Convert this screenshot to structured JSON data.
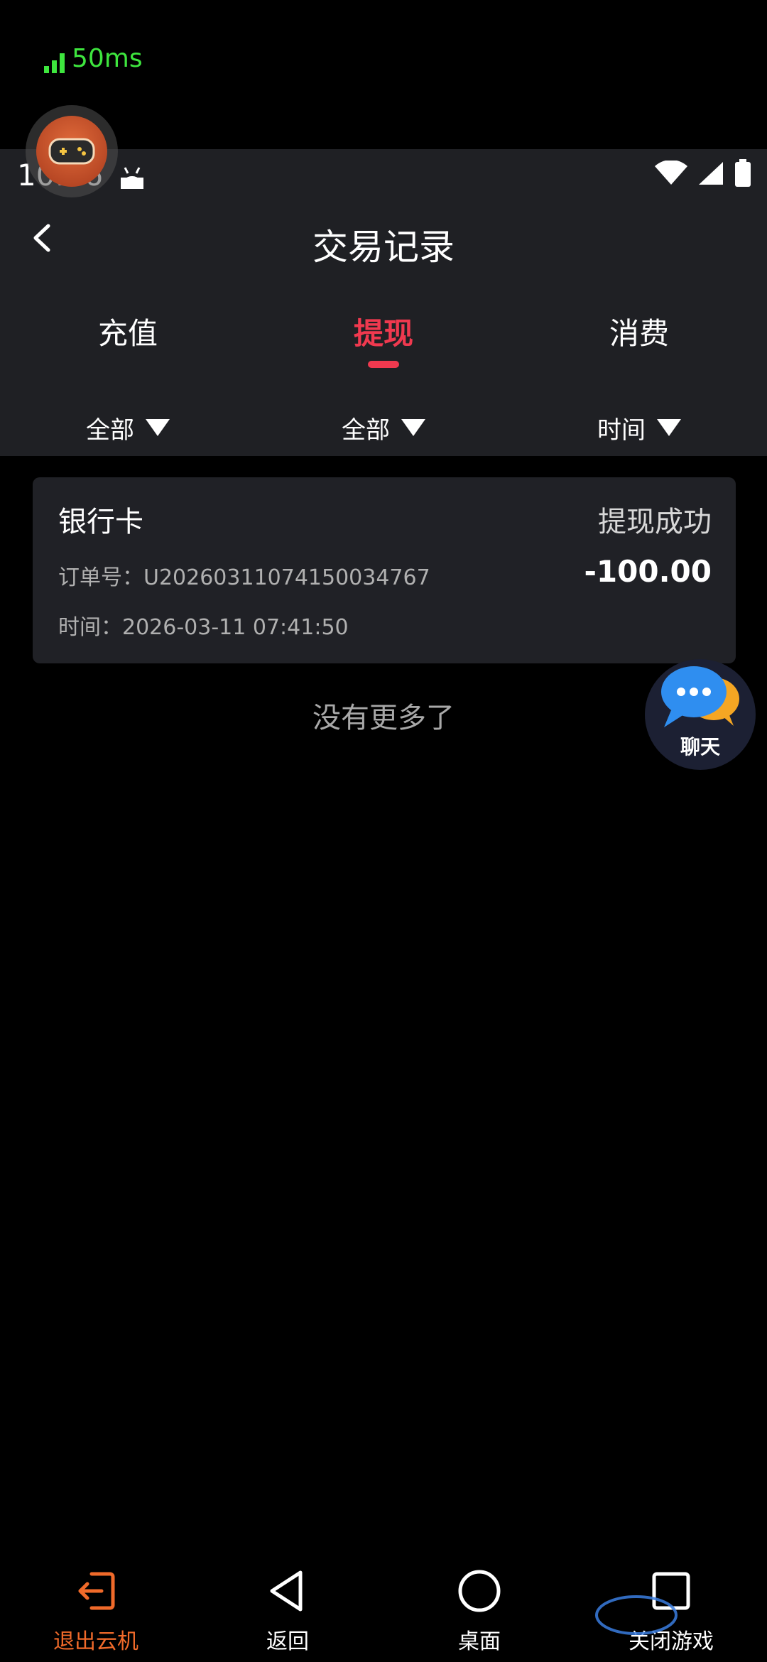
{
  "overlay": {
    "latency": "50ms",
    "latency_color": "#3ee63e"
  },
  "status_bar": {
    "time": "10:56"
  },
  "header": {
    "title": "交易记录"
  },
  "tabs": [
    {
      "label": "充值",
      "active": false
    },
    {
      "label": "提现",
      "active": true
    },
    {
      "label": "消费",
      "active": false
    }
  ],
  "filters": [
    {
      "label": "全部"
    },
    {
      "label": "全部"
    },
    {
      "label": "时间"
    }
  ],
  "records": [
    {
      "method": "银行卡",
      "status": "提现成功",
      "order_no": "订单号：U20260311074150034767",
      "amount": "-100.00",
      "time": "时间：2026-03-11 07:41:50"
    }
  ],
  "list_end": "没有更多了",
  "chat_button": {
    "label": "聊天"
  },
  "bottom_bar": {
    "exit": "退出云机",
    "back": "返回",
    "home": "桌面",
    "close_game": "关闭游戏"
  },
  "colors": {
    "accent": "#f0394f",
    "exit_orange": "#f06a2a",
    "panel": "#1f2024"
  }
}
